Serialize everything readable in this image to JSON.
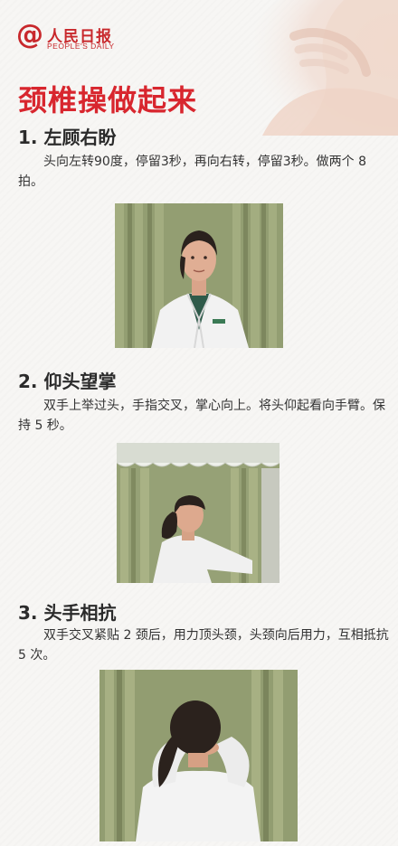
{
  "brand": {
    "logo_at": "@",
    "logo_cn": "人民日报",
    "logo_en": "PEOPLE'S DAILY"
  },
  "title": "颈椎操做起来",
  "sections": [
    {
      "heading": "1. 左顾右盼",
      "text": "头向左转90度，停留3秒，再向右转，停留3秒。做两个 8 拍。"
    },
    {
      "heading": "2. 仰头望掌",
      "text": "双手上举过头，手指交叉，掌心向上。将头仰起看向手臂。保持 5 秒。"
    },
    {
      "heading": "3. 头手相抗",
      "text": "双手交叉紧贴 2 颈后，用力顶头颈，头颈向后用力，互相抵抗 5 次。"
    }
  ],
  "colors": {
    "accent": "#d8262e",
    "brand": "#c8282c",
    "curtain": "#8f9a6f",
    "coat": "#f2f2f2"
  }
}
